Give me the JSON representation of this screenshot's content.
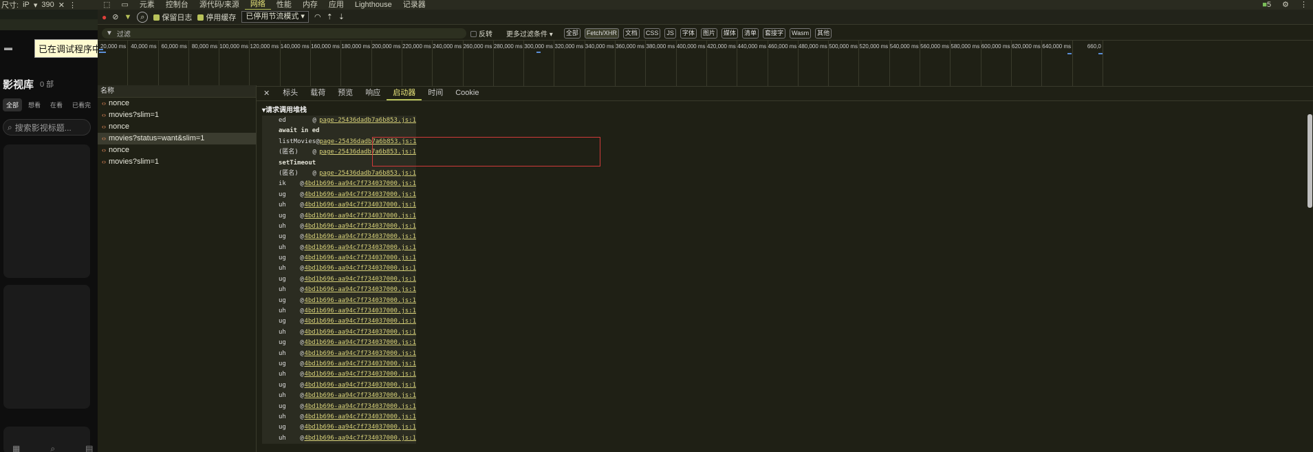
{
  "left_panel": {
    "device_label": "尺寸:",
    "device_value": "iP",
    "device_width": "390",
    "tooltip": "已在调试程序中",
    "library_title": "影视库",
    "library_count": "0 部",
    "tabs": [
      "全部",
      "想看",
      "在看",
      "已看完"
    ],
    "search_placeholder": "搜索影视标题..."
  },
  "devtools": {
    "tabs": [
      "元素",
      "控制台",
      "源代码/来源",
      "网络",
      "性能",
      "内存",
      "应用",
      "Lighthouse",
      "记录器"
    ],
    "active_tab": "网络",
    "issues_count": "5",
    "toolbar": {
      "preserve_log": "保留日志",
      "disable_cache": "停用缓存",
      "throttle": "已停用节流模式"
    },
    "filter": {
      "placeholder": "过滤",
      "invert": "反转",
      "more_filters": "更多过滤条件",
      "types": [
        "全部",
        "Fetch/XHR",
        "文档",
        "CSS",
        "JS",
        "字体",
        "图片",
        "媒体",
        "清单",
        "套接字",
        "Wasm",
        "其他"
      ]
    },
    "timeline_ticks": [
      "20,000 ms",
      "40,000 ms",
      "60,000 ms",
      "80,000 ms",
      "100,000 ms",
      "120,000 ms",
      "140,000 ms",
      "160,000 ms",
      "180,000 ms",
      "200,000 ms",
      "220,000 ms",
      "240,000 ms",
      "260,000 ms",
      "280,000 ms",
      "300,000 ms",
      "320,000 ms",
      "340,000 ms",
      "360,000 ms",
      "380,000 ms",
      "400,000 ms",
      "420,000 ms",
      "440,000 ms",
      "460,000 ms",
      "480,000 ms",
      "500,000 ms",
      "520,000 ms",
      "540,000 ms",
      "560,000 ms",
      "580,000 ms",
      "600,000 ms",
      "620,000 ms",
      "640,000 ms",
      "660,0"
    ],
    "name_header": "名称",
    "requests": [
      "nonce",
      "movies?slim=1",
      "nonce",
      "movies?status=want&slim=1",
      "nonce",
      "movies?slim=1"
    ],
    "selected_request": 3,
    "detail_tabs": [
      "标头",
      "载荷",
      "预览",
      "响应",
      "启动器",
      "时间",
      "Cookie"
    ],
    "active_detail_tab": "启动器",
    "stack": {
      "section_title": "请求调用堆栈",
      "rows": [
        {
          "fn": "ed",
          "at": "@",
          "link": "page-25436dadb7a6b853.js:1"
        },
        {
          "group": "await in ed"
        },
        {
          "fn": "listMovies",
          "at": "@",
          "link": "page-25436dadb7a6b853.js:1"
        },
        {
          "fn": "(匿名)",
          "at": "@",
          "link": "page-25436dadb7a6b853.js:1"
        },
        {
          "group": "setTimeout"
        },
        {
          "fn": "(匿名)",
          "at": "@",
          "link": "page-25436dadb7a6b853.js:1"
        },
        {
          "fn": "ik",
          "at": "@",
          "link": "4bd1b696-aa94c7f734037000.js:1"
        },
        {
          "fn": "ug",
          "at": "@",
          "link": "4bd1b696-aa94c7f734037000.js:1"
        },
        {
          "fn": "uh",
          "at": "@",
          "link": "4bd1b696-aa94c7f734037000.js:1"
        },
        {
          "fn": "ug",
          "at": "@",
          "link": "4bd1b696-aa94c7f734037000.js:1"
        },
        {
          "fn": "uh",
          "at": "@",
          "link": "4bd1b696-aa94c7f734037000.js:1"
        },
        {
          "fn": "ug",
          "at": "@",
          "link": "4bd1b696-aa94c7f734037000.js:1"
        },
        {
          "fn": "uh",
          "at": "@",
          "link": "4bd1b696-aa94c7f734037000.js:1"
        },
        {
          "fn": "ug",
          "at": "@",
          "link": "4bd1b696-aa94c7f734037000.js:1"
        },
        {
          "fn": "uh",
          "at": "@",
          "link": "4bd1b696-aa94c7f734037000.js:1"
        },
        {
          "fn": "ug",
          "at": "@",
          "link": "4bd1b696-aa94c7f734037000.js:1"
        },
        {
          "fn": "uh",
          "at": "@",
          "link": "4bd1b696-aa94c7f734037000.js:1"
        },
        {
          "fn": "ug",
          "at": "@",
          "link": "4bd1b696-aa94c7f734037000.js:1"
        },
        {
          "fn": "uh",
          "at": "@",
          "link": "4bd1b696-aa94c7f734037000.js:1"
        },
        {
          "fn": "ug",
          "at": "@",
          "link": "4bd1b696-aa94c7f734037000.js:1"
        },
        {
          "fn": "uh",
          "at": "@",
          "link": "4bd1b696-aa94c7f734037000.js:1"
        },
        {
          "fn": "ug",
          "at": "@",
          "link": "4bd1b696-aa94c7f734037000.js:1"
        },
        {
          "fn": "uh",
          "at": "@",
          "link": "4bd1b696-aa94c7f734037000.js:1"
        },
        {
          "fn": "ug",
          "at": "@",
          "link": "4bd1b696-aa94c7f734037000.js:1"
        },
        {
          "fn": "uh",
          "at": "@",
          "link": "4bd1b696-aa94c7f734037000.js:1"
        },
        {
          "fn": "ug",
          "at": "@",
          "link": "4bd1b696-aa94c7f734037000.js:1"
        },
        {
          "fn": "uh",
          "at": "@",
          "link": "4bd1b696-aa94c7f734037000.js:1"
        },
        {
          "fn": "ug",
          "at": "@",
          "link": "4bd1b696-aa94c7f734037000.js:1"
        },
        {
          "fn": "uh",
          "at": "@",
          "link": "4bd1b696-aa94c7f734037000.js:1"
        },
        {
          "fn": "ug",
          "at": "@",
          "link": "4bd1b696-aa94c7f734037000.js:1"
        },
        {
          "fn": "uh",
          "at": "@",
          "link": "4bd1b696-aa94c7f734037000.js:1"
        }
      ]
    }
  },
  "colors": {
    "accent": "#b8c25a",
    "link": "#d9d37a",
    "highlight_box": "#d23a3a",
    "record_red": "#e0403a"
  }
}
